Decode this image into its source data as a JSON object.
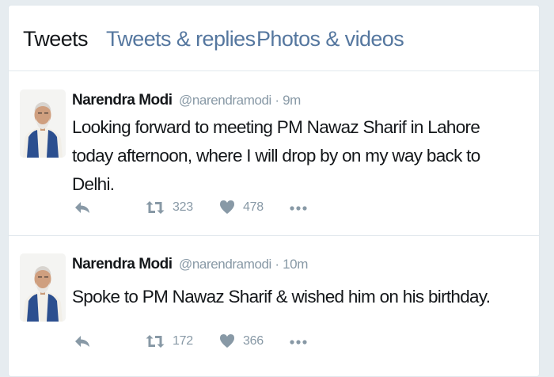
{
  "tabs": [
    {
      "label": "Tweets",
      "active": true
    },
    {
      "label": "Tweets & replies",
      "active": false
    },
    {
      "label": "Photos & videos",
      "active": false
    }
  ],
  "tweets": [
    {
      "name": "Narendra Modi",
      "handle": "@narendramodi",
      "separator": "·",
      "time": "9m",
      "text": "Looking forward to meeting PM Nawaz Sharif in Lahore today afternoon, where I will drop by on my way back to Delhi.",
      "retweets": "323",
      "likes": "478"
    },
    {
      "name": "Narendra Modi",
      "handle": "@narendramodi",
      "separator": "·",
      "time": "10m",
      "text": "Spoke to PM Nawaz Sharif & wished him on his birthday.",
      "retweets": "172",
      "likes": "366"
    }
  ],
  "icons": {
    "reply": "reply-icon",
    "retweet": "retweet-icon",
    "like": "heart-icon",
    "more": "more-icon",
    "avatar": "profile-photo"
  },
  "colors": {
    "text": "#14171a",
    "muted": "#8899a6",
    "link": "#55779f",
    "border": "#e1e8ed",
    "background": "#e6ecf0"
  }
}
